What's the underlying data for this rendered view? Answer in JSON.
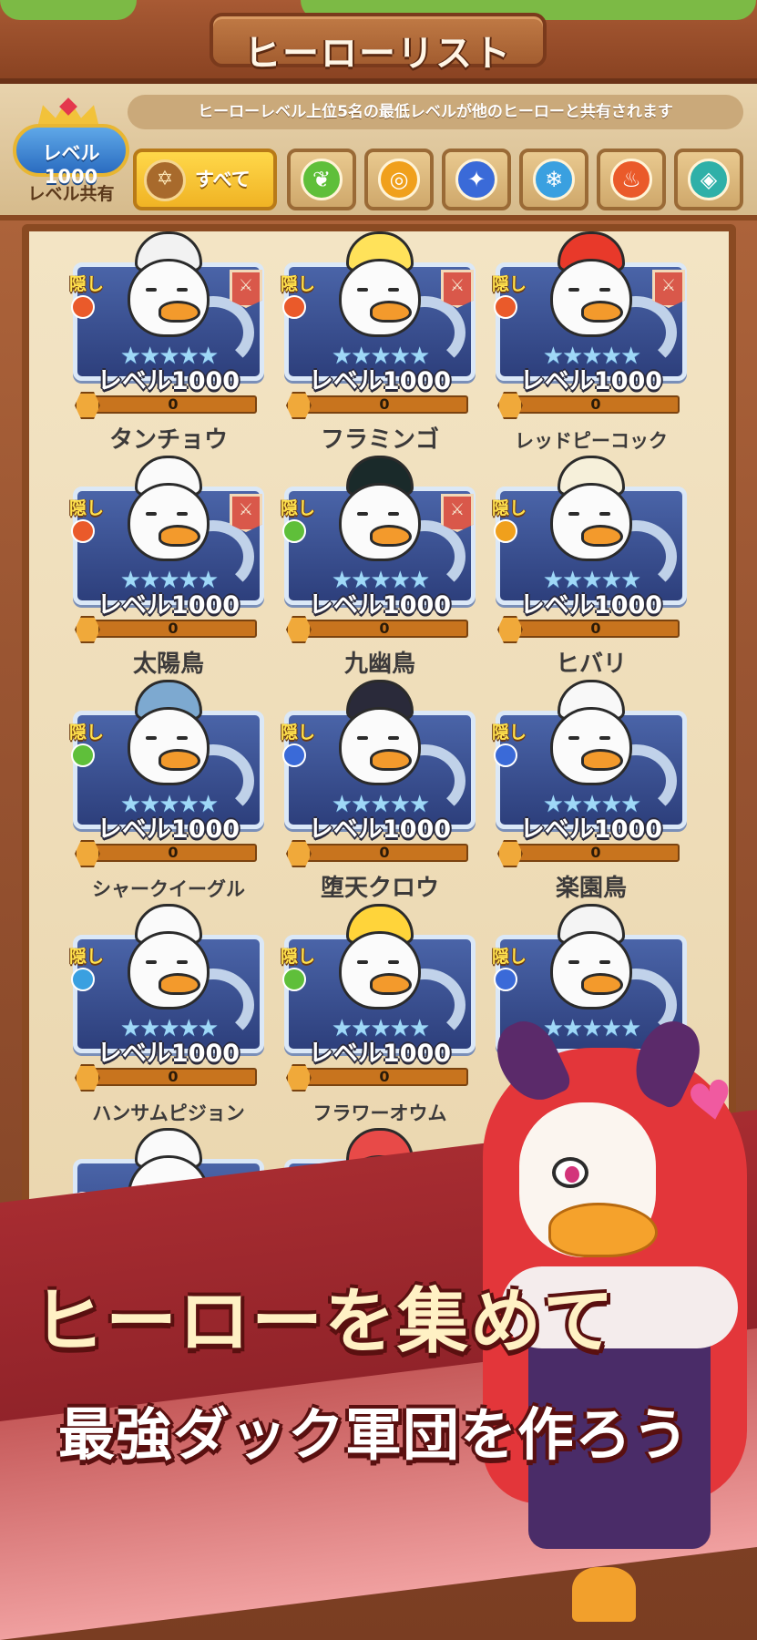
{
  "header": {
    "title": "ヒーローリスト"
  },
  "level_share": {
    "badge": "レベル1000",
    "caption": "レベル共有",
    "note": "ヒーローレベル上位5名の最低レベルが他のヒーローと共有されます"
  },
  "filters": {
    "all_label": "すべて",
    "elements": [
      {
        "icon": "leaf-icon",
        "color": "#5fbf3a",
        "glyph": "❦"
      },
      {
        "icon": "sun-icon",
        "color": "#f0a01c",
        "glyph": "◎"
      },
      {
        "icon": "vortex-icon",
        "color": "#3a6ad8",
        "glyph": "✦"
      },
      {
        "icon": "snowflake-icon",
        "color": "#3aa0e0",
        "glyph": "❄"
      },
      {
        "icon": "flame-icon",
        "color": "#ea5a2a",
        "glyph": "♨"
      },
      {
        "icon": "crystal-icon",
        "color": "#2fb0a8",
        "glyph": "◈"
      }
    ]
  },
  "hero_common": {
    "hidden": "隠し",
    "level": "レベル1000",
    "xp": "0",
    "stars": "★★★★★"
  },
  "heroes": [
    {
      "name": "タンチョウ"
    },
    {
      "name": "フラミンゴ"
    },
    {
      "name": "レッドピーコック"
    },
    {
      "name": "太陽鳥"
    },
    {
      "name": "九幽鳥"
    },
    {
      "name": "ヒバリ"
    },
    {
      "name": "シャークイーグル"
    },
    {
      "name": "堕天クロウ"
    },
    {
      "name": "楽園鳥"
    },
    {
      "name": "ハンサムピジョン"
    },
    {
      "name": "フラワーオウム"
    },
    {
      "name": ""
    },
    {
      "name": ""
    },
    {
      "name": ""
    }
  ],
  "promo": {
    "line1": "ヒーローを集めて",
    "line2": "最強ダック軍団を作ろう"
  }
}
